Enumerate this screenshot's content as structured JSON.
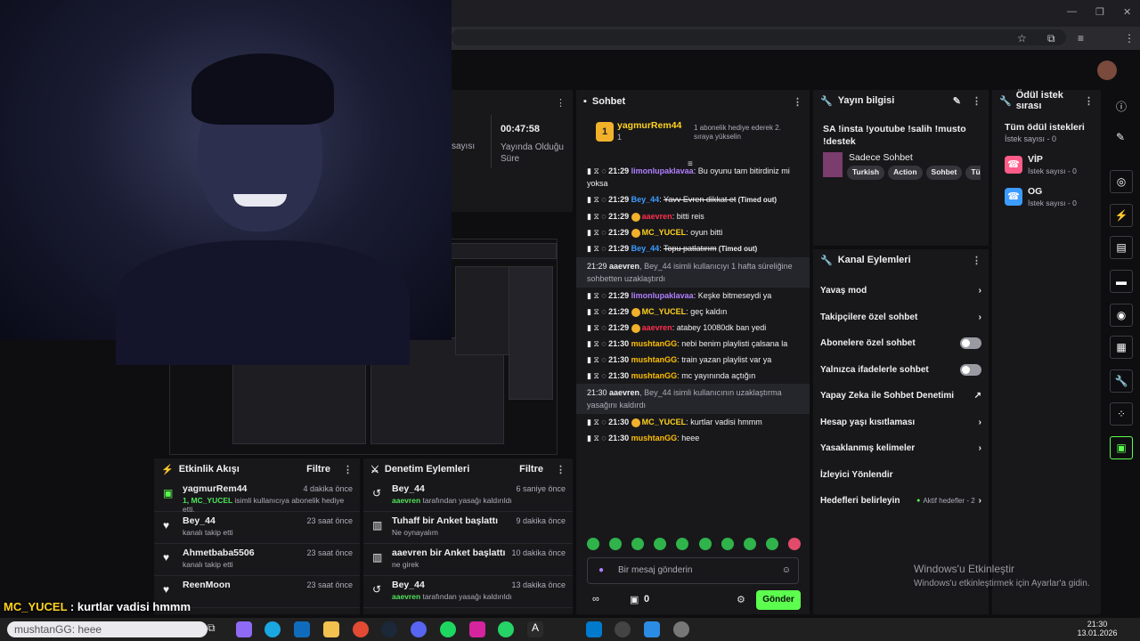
{
  "stats": {
    "duration": "00:47:58",
    "duration_label": "Yayında Olduğu Süre",
    "partial_label": "sayısı"
  },
  "activity": {
    "title": "Etkinlik Akışı",
    "filter": "Filtre",
    "items": [
      {
        "name": "yagmurRem44",
        "time": "4 dakika önce",
        "sub_highlight": "1, MC_YUCEL",
        "sub": "isimli kullanıcıya abonelik hediye etti.",
        "icon": "gift-icon"
      },
      {
        "name": "Bey_44",
        "time": "23 saat önce",
        "sub": "kanalı takip etti",
        "icon": "heart-icon"
      },
      {
        "name": "Ahmetbaba5506",
        "time": "23 saat önce",
        "sub": "kanalı takip etti",
        "icon": "heart-icon"
      },
      {
        "name": "ReenMoon",
        "time": "23 saat önce",
        "sub": "",
        "icon": "heart-icon"
      }
    ]
  },
  "mod": {
    "title": "Denetim Eylemleri",
    "filter": "Filtre",
    "items": [
      {
        "name": "Bey_44",
        "time": "6 saniye önce",
        "sub_highlight": "aaevren",
        "sub": "tarafından yasağı kaldırıldı",
        "icon": "undo-icon"
      },
      {
        "name": "Tuhaff bir Anket başlattı",
        "time": "9 dakika önce",
        "sub": "Ne oynayalım",
        "icon": "poll-icon"
      },
      {
        "name": "aaevren bir Anket başlattı",
        "time": "10 dakika önce",
        "sub": "ne girek",
        "icon": "poll-icon"
      },
      {
        "name": "Bey_44",
        "time": "13 dakika önce",
        "sub_highlight": "aaevren",
        "sub": "tarafından yasağı kaldırıldı",
        "icon": "undo-icon"
      }
    ]
  },
  "chat": {
    "title": "Sohbet",
    "pinned_user": "yagmurRem44",
    "pinned_count": "1",
    "pinned_text": "1 abonelik hediye ederek 2. sıraya yükselin",
    "messages": [
      {
        "time": "21:29",
        "user": "limonlupaklavaa",
        "cls": "u-lim",
        "text": "Bu oyunu tam bitirdiniz mi yoksa"
      },
      {
        "time": "21:29",
        "user": "Bey_44",
        "cls": "u-bey",
        "text": "Yavv Evren dikkat et",
        "strike": true,
        "note": "(Timed out)"
      },
      {
        "time": "21:29",
        "user": "aaevren",
        "cls": "u-aa",
        "text": "bitti reis"
      },
      {
        "time": "21:29",
        "user": "MC_YUCEL",
        "cls": "u-mc",
        "text": "oyun bitti"
      },
      {
        "time": "21:29",
        "user": "Bey_44",
        "cls": "u-bey",
        "text": "Topu patlatırım",
        "strike": true,
        "note": "(Timed out)"
      }
    ],
    "sys1": {
      "time": "21:29",
      "user": "aaevren",
      "text": ", Bey_44 isimli kullanıcıyı 1 hafta süreliğine sohbetten uzaklaştırdı"
    },
    "messages2": [
      {
        "time": "21:29",
        "user": "limonlupaklavaa",
        "cls": "u-lim",
        "text": "Keşke bitmeseydi ya"
      },
      {
        "time": "21:29",
        "user": "MC_YUCEL",
        "cls": "u-mc",
        "text": "geç kaldın"
      },
      {
        "time": "21:29",
        "user": "aaevren",
        "cls": "u-aa",
        "text": "atabey 10080dk ban yedi"
      },
      {
        "time": "21:30",
        "user": "mushtanGG",
        "cls": "u-mu",
        "text": "nebi benim playlisti çalsana la"
      },
      {
        "time": "21:30",
        "user": "mushtanGG",
        "cls": "u-mu",
        "text": "train yazan playlist var ya"
      },
      {
        "time": "21:30",
        "user": "mushtanGG",
        "cls": "u-mu",
        "text": "mc yayınında açtığın"
      }
    ],
    "sys2": {
      "time": "21:30",
      "user": "aaevren",
      "text": ", Bey_44 isimli kullanıcının uzaklaştırma yasağını kaldırdı"
    },
    "messages3": [
      {
        "time": "21:30",
        "user": "MC_YUCEL",
        "cls": "u-mc",
        "text": "kurtlar vadisi hmmm"
      },
      {
        "time": "21:30",
        "user": "mushtanGG",
        "cls": "u-mu",
        "text": "heee"
      }
    ],
    "input_placeholder": "Bir mesaj gönderin",
    "points": "0",
    "send": "Gönder"
  },
  "info": {
    "title": "Yayın bilgisi",
    "stream_title": "SA !insta !youtube !salih !musto !destek",
    "category": "Sadece Sohbet",
    "tags": [
      "Turkish",
      "Action",
      "Sohbet",
      "Tür"
    ]
  },
  "actions": {
    "title": "Kanal Eylemleri",
    "items": [
      {
        "label": "Yavaş mod",
        "kind": "chevron"
      },
      {
        "label": "Takipçilere özel sohbet",
        "kind": "chevron"
      },
      {
        "label": "Abonelere özel sohbet",
        "kind": "toggle"
      },
      {
        "label": "Yalnızca ifadelerle sohbet",
        "kind": "toggle"
      },
      {
        "label": "Yapay Zeka ile Sohbet Denetimi",
        "kind": "external"
      },
      {
        "label": "Hesap yaşı kısıtlaması",
        "kind": "chevron"
      },
      {
        "label": "Yasaklanmış kelimeler",
        "kind": "chevron"
      },
      {
        "label": "İzleyici Yönlendir",
        "kind": "none"
      },
      {
        "label": "Hedefleri belirleyin",
        "kind": "goal",
        "extra": "Aktif hedefler - 2"
      }
    ]
  },
  "rewards": {
    "title": "Ödül istek sırası",
    "all_label": "Tüm ödül istekleri",
    "all_count": "İstek sayısı - 0",
    "items": [
      {
        "name": "VİP",
        "count": "İstek sayısı - 0",
        "color": "#ff5c8a"
      },
      {
        "name": "OG",
        "count": "İstek sayısı - 0",
        "color": "#3d9cff"
      }
    ]
  },
  "overlay": {
    "user": "MC_YUCEL",
    "text": ": kurtlar vadisi hmmm",
    "user2": "mushtanGG",
    "text2": ": heee"
  },
  "watermark": {
    "title": "Windows'u Etkinleştir",
    "sub": "Windows'u etkinleştirmek için Ayarlar'a gidin."
  },
  "clock": {
    "time": "21:30",
    "date": "13.01.2026"
  }
}
